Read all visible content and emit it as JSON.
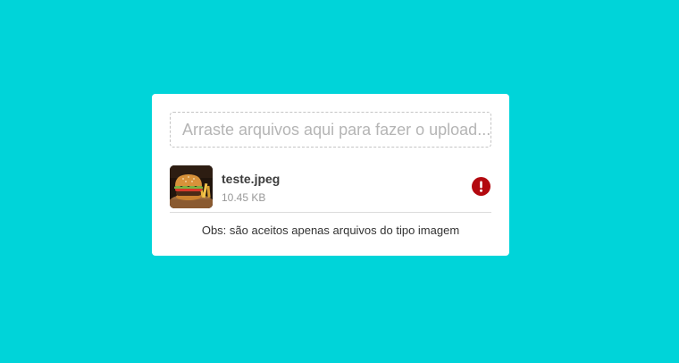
{
  "upload": {
    "dropzone_text": "Arraste arquivos aqui para fazer o upload...",
    "files": [
      {
        "name": "teste.jpeg",
        "size": "10.45 KB",
        "status": "error",
        "status_icon": "error-icon"
      }
    ],
    "note": "Obs: são aceitos apenas arquivos do tipo imagem"
  },
  "colors": {
    "background": "#00d4d9",
    "card": "#ffffff",
    "error": "#b3090f",
    "placeholder": "#b5b5b5"
  }
}
